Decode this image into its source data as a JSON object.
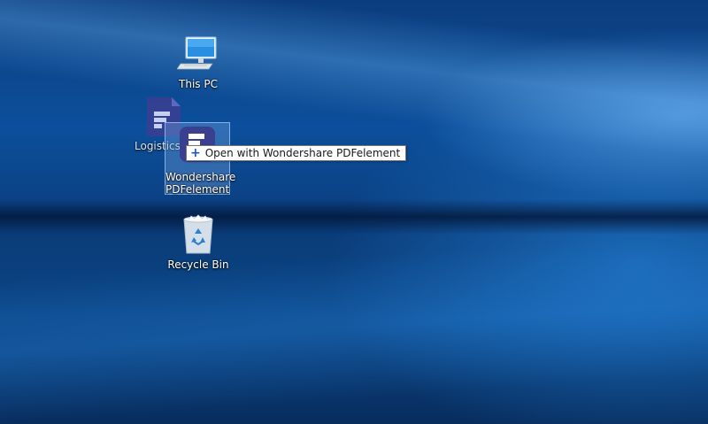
{
  "desktop": {
    "icons": {
      "this_pc": {
        "label": "This PC",
        "icon": "computer-monitor-icon"
      },
      "logistics": {
        "label": "Logistics.pdf",
        "icon": "pdf-document-icon"
      },
      "pdfelement": {
        "label_line1": "Wondershare",
        "label_line2": "PDFelement",
        "icon": "pdfelement-app-icon"
      },
      "recycle_bin": {
        "label": "Recycle Bin",
        "icon": "recycle-bin-icon"
      }
    },
    "drag_tooltip": {
      "symbol": "+",
      "text": "Open with Wondershare PDFelement"
    }
  },
  "colors": {
    "wallpaper_base": "#0b3d7e",
    "selection_fill": "#78aae6",
    "pdfelement_brand": "#3a3f8f",
    "tooltip_plus": "#1a57c2"
  }
}
